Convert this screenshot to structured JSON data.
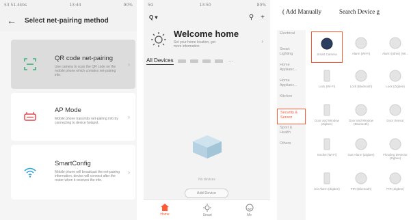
{
  "panel1": {
    "status_left": "53 51.4kbs",
    "status_time": "13:44",
    "status_right": "90%",
    "title": "Select net-pairing method",
    "methods": [
      {
        "title": "QR code net-pairing",
        "desc": "Use camera to scan the QR code on the mobile phone which contains net-pairing info."
      },
      {
        "title": "AP Mode",
        "desc": "Mobile phone transmits net-pairing info by connecting to device hotspot."
      },
      {
        "title": "SmartConfig",
        "desc": "Mobile phone will broadcast the net-pairing information, device will connect after the router when it receives the info."
      }
    ]
  },
  "panel2": {
    "status_left": "5G",
    "status_time": "13:50",
    "status_right": "80%",
    "home_label": "Q",
    "welcome_title": "Welcome home",
    "welcome_sub": "Set your home location, get more information",
    "tab_all": "All Devices",
    "no_devices": "No devices",
    "add_device": "Add Device",
    "nav": [
      {
        "label": "Home",
        "icon": "home-icon"
      },
      {
        "label": "Smart",
        "icon": "smart-icon"
      },
      {
        "label": "Me",
        "icon": "me-icon"
      }
    ]
  },
  "panel3": {
    "tab_manual": "( Add Manually",
    "tab_search": "Search Device g",
    "categories": [
      "Electrical",
      "Smart Lighting",
      "Home Applianc...",
      "Home Applianc...",
      "Kitchen",
      "Security & Sensor",
      "Sport & Health",
      "Others"
    ],
    "active_category": 5,
    "devices": [
      "Smart Camera",
      "Alarm (Wi-Fi)",
      "Alarm (other) (Wi...",
      "Lock (Wi-Fi)",
      "Lock (Bluetooth)",
      "Lock (Zigbee)",
      "Door and Window (Zigbee)",
      "Door and Window (Bluetooth)",
      "Door Sensor",
      "Smoke (Wi-Fi)",
      "Gas Alarm (Zigbee)",
      "Flooding Detector (Zigbee)",
      "CO Alarm (Zigbee)",
      "PIR (Bluetooth)",
      "PIR (Zigbee)"
    ]
  }
}
